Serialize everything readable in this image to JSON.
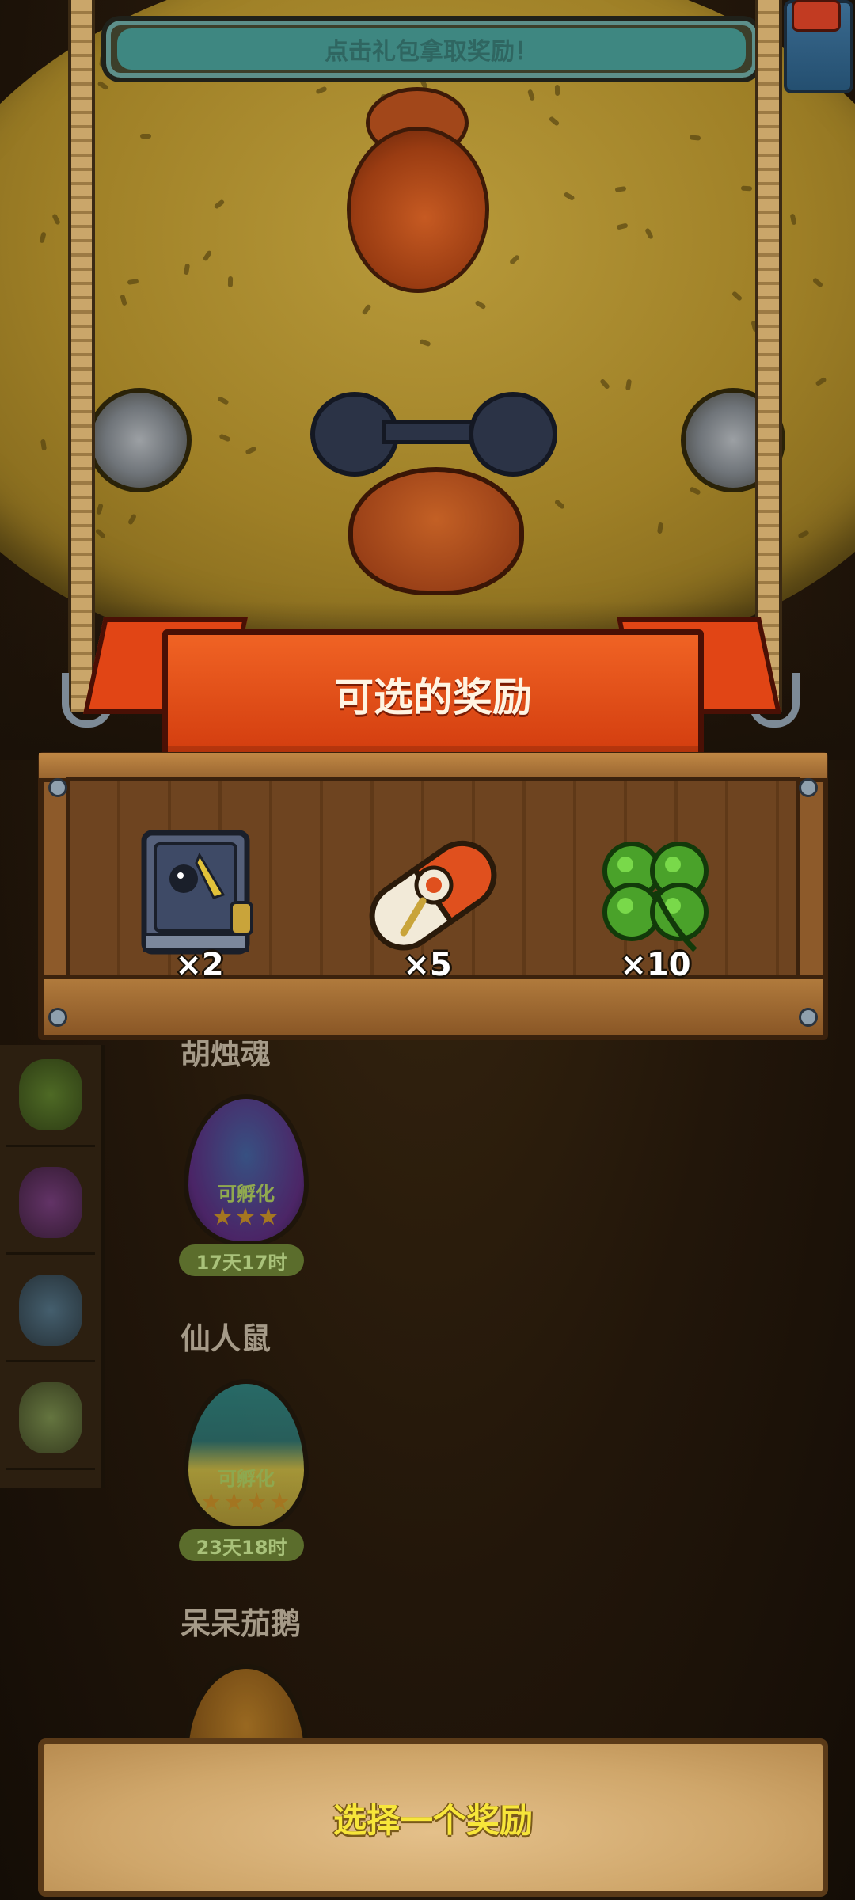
{
  "header": {
    "hint_text": "点击礼包拿取奖励！"
  },
  "reward_panel": {
    "title": "可选的奖励",
    "rewards": [
      {
        "icon": "armored-book-icon",
        "count": "×2"
      },
      {
        "icon": "pill-capsule-icon",
        "count": "×5"
      },
      {
        "icon": "four-leaf-clover-icon",
        "count": "×10"
      }
    ]
  },
  "sidebar": {
    "items": [
      {
        "icon": "cactus-creature-icon"
      },
      {
        "icon": "eggplant-creature-icon"
      },
      {
        "icon": "chameleon-creature-icon"
      },
      {
        "icon": "grass-creature-icon"
      }
    ]
  },
  "egg_list": [
    {
      "name": "胡烛魂",
      "status": "可孵化",
      "stars": "★★★",
      "timer": "17天17时"
    },
    {
      "name": "仙人鼠",
      "status": "可孵化",
      "stars": "★★★★",
      "timer": "23天18时"
    },
    {
      "name": "呆呆茄鹅"
    }
  ],
  "bottom": {
    "select_label": "选择一个奖励"
  },
  "colors": {
    "ribbon": "#e14515",
    "select_text": "#f7e63a",
    "hint_bar": "#3e8781"
  }
}
